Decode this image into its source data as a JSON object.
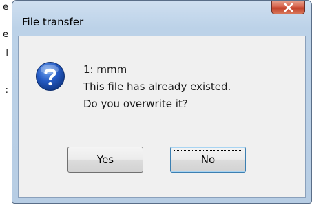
{
  "background": {
    "edge_text": [
      "e",
      "e",
      "l",
      ":"
    ]
  },
  "dialog": {
    "title": "File transfer",
    "close_symbol": "X",
    "icon": "question-icon",
    "message_lines": [
      "1: mmm",
      "This file has already existed.",
      "Do you overwrite it?"
    ],
    "buttons": {
      "yes": {
        "mnemonic": "Y",
        "rest": "es"
      },
      "no": {
        "mnemonic": "N",
        "rest": "o"
      }
    }
  },
  "colors": {
    "frame": "#bcd2e8",
    "close_button": "#c2412a",
    "icon_blue": "#1e4fb0",
    "client": "#f0f0f0"
  }
}
